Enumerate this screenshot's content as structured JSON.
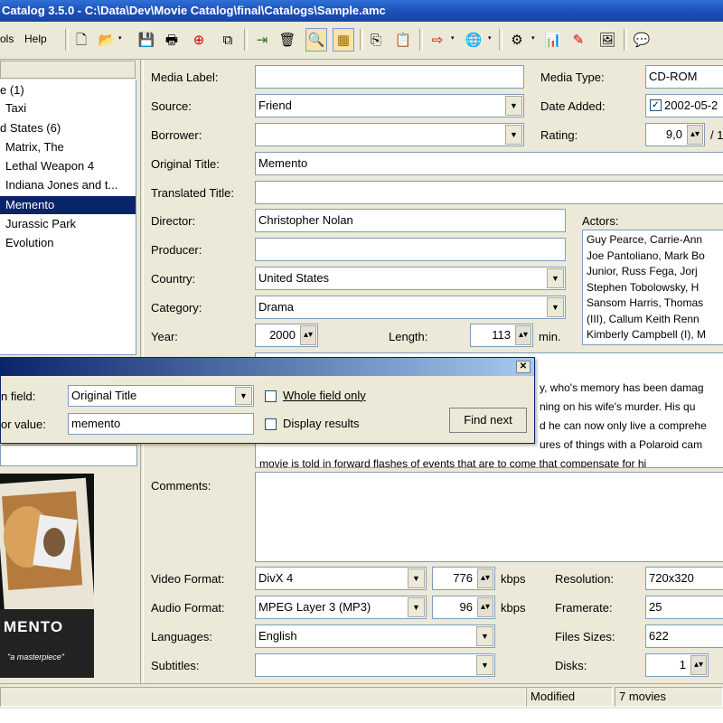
{
  "window": {
    "title": "Catalog 3.5.0 - C:\\Data\\Dev\\Movie Catalog\\final\\Catalogs\\Sample.amc"
  },
  "menu": {
    "tools": "ols",
    "help": "Help"
  },
  "toolbar": {
    "icons": [
      "new-document-icon",
      "open-icon",
      "save-icon",
      "print-icon",
      "add-movie-icon",
      "copy-movie-icon",
      "import-icon",
      "delete-icon",
      "find-icon",
      "filter-icon",
      "copy-icon",
      "paste-icon",
      "export-icon",
      "web-icon",
      "settings-icon",
      "statistics-icon",
      "script-icon",
      "picture-icon",
      "help-icon"
    ]
  },
  "tree": {
    "items": [
      {
        "label": "e (1)",
        "indent": 0,
        "selected": false
      },
      {
        "label": "Taxi",
        "indent": 1,
        "selected": false
      },
      {
        "label": "d States (6)",
        "indent": 0,
        "selected": false
      },
      {
        "label": "Matrix, The",
        "indent": 1,
        "selected": false
      },
      {
        "label": "Lethal Weapon 4",
        "indent": 1,
        "selected": false
      },
      {
        "label": "Indiana Jones and t...",
        "indent": 1,
        "selected": false
      },
      {
        "label": "Memento",
        "indent": 1,
        "selected": true
      },
      {
        "label": "Jurassic Park",
        "indent": 1,
        "selected": false
      },
      {
        "label": "Evolution",
        "indent": 1,
        "selected": false
      }
    ]
  },
  "form": {
    "media_label": {
      "label": "Media Label:",
      "value": ""
    },
    "media_type": {
      "label": "Media Type:",
      "value": "CD-ROM"
    },
    "source": {
      "label": "Source:",
      "value": "Friend"
    },
    "date_added": {
      "label": "Date Added:",
      "value": "2002-05-2"
    },
    "borrower": {
      "label": "Borrower:",
      "value": ""
    },
    "rating": {
      "label": "Rating:",
      "value": "9,0",
      "suffix": "/ 1"
    },
    "original_title": {
      "label": "Original Title:",
      "value": "Memento"
    },
    "translated_title": {
      "label": "Translated Title:",
      "value": ""
    },
    "director": {
      "label": "Director:",
      "value": "Christopher Nolan"
    },
    "producer": {
      "label": "Producer:",
      "value": ""
    },
    "country": {
      "label": "Country:",
      "value": "United States"
    },
    "category": {
      "label": "Category:",
      "value": "Drama"
    },
    "year": {
      "label": "Year:",
      "value": "2000"
    },
    "length": {
      "label": "Length:",
      "value": "113",
      "unit": "min."
    },
    "actors": {
      "label": "Actors:",
      "lines": [
        "Guy Pearce, Carrie-Ann",
        "Joe Pantoliano, Mark Bo",
        "Junior, Russ Fega, Jorj",
        "Stephen Tobolowsky, H",
        "Sansom Harris, Thomas",
        "(III), Callum Keith Renn",
        "Kimberly Campbell (I), M"
      ]
    },
    "description_lines": [
      "y, who's memory has been damag",
      "ning on his wife's murder. His qu",
      "d he can now only live a comprehe",
      "ures of things with a Polaroid cam",
      "movie is told in forward flashes of events that are to come that compensate for hi"
    ],
    "comments": {
      "label": "Comments:",
      "value": ""
    },
    "video_format": {
      "label": "Video Format:",
      "value": "DivX 4"
    },
    "video_bitrate": {
      "value": "776",
      "unit": "kbps"
    },
    "resolution": {
      "label": "Resolution:",
      "value": "720x320"
    },
    "audio_format": {
      "label": "Audio Format:",
      "value": "MPEG Layer 3 (MP3)"
    },
    "audio_bitrate": {
      "value": "96",
      "unit": "kbps"
    },
    "framerate": {
      "label": "Framerate:",
      "value": "25"
    },
    "languages": {
      "label": "Languages:",
      "value": "English"
    },
    "files_sizes": {
      "label": "Files Sizes:",
      "value": "622"
    },
    "subtitles": {
      "label": "Subtitles:",
      "value": ""
    },
    "disks": {
      "label": "Disks:",
      "value": "1"
    }
  },
  "find_dialog": {
    "search_field_label": "n field:",
    "search_field_value": "Original Title",
    "value_label": "or value:",
    "value": "memento",
    "whole_field_only": "Whole field only",
    "display_results": "Display results",
    "find_next": "Find next"
  },
  "poster": {
    "text": "MENTO",
    "tagline": "\"a masterpiece\""
  },
  "status": {
    "state": "Modified",
    "count": "7 movies"
  }
}
